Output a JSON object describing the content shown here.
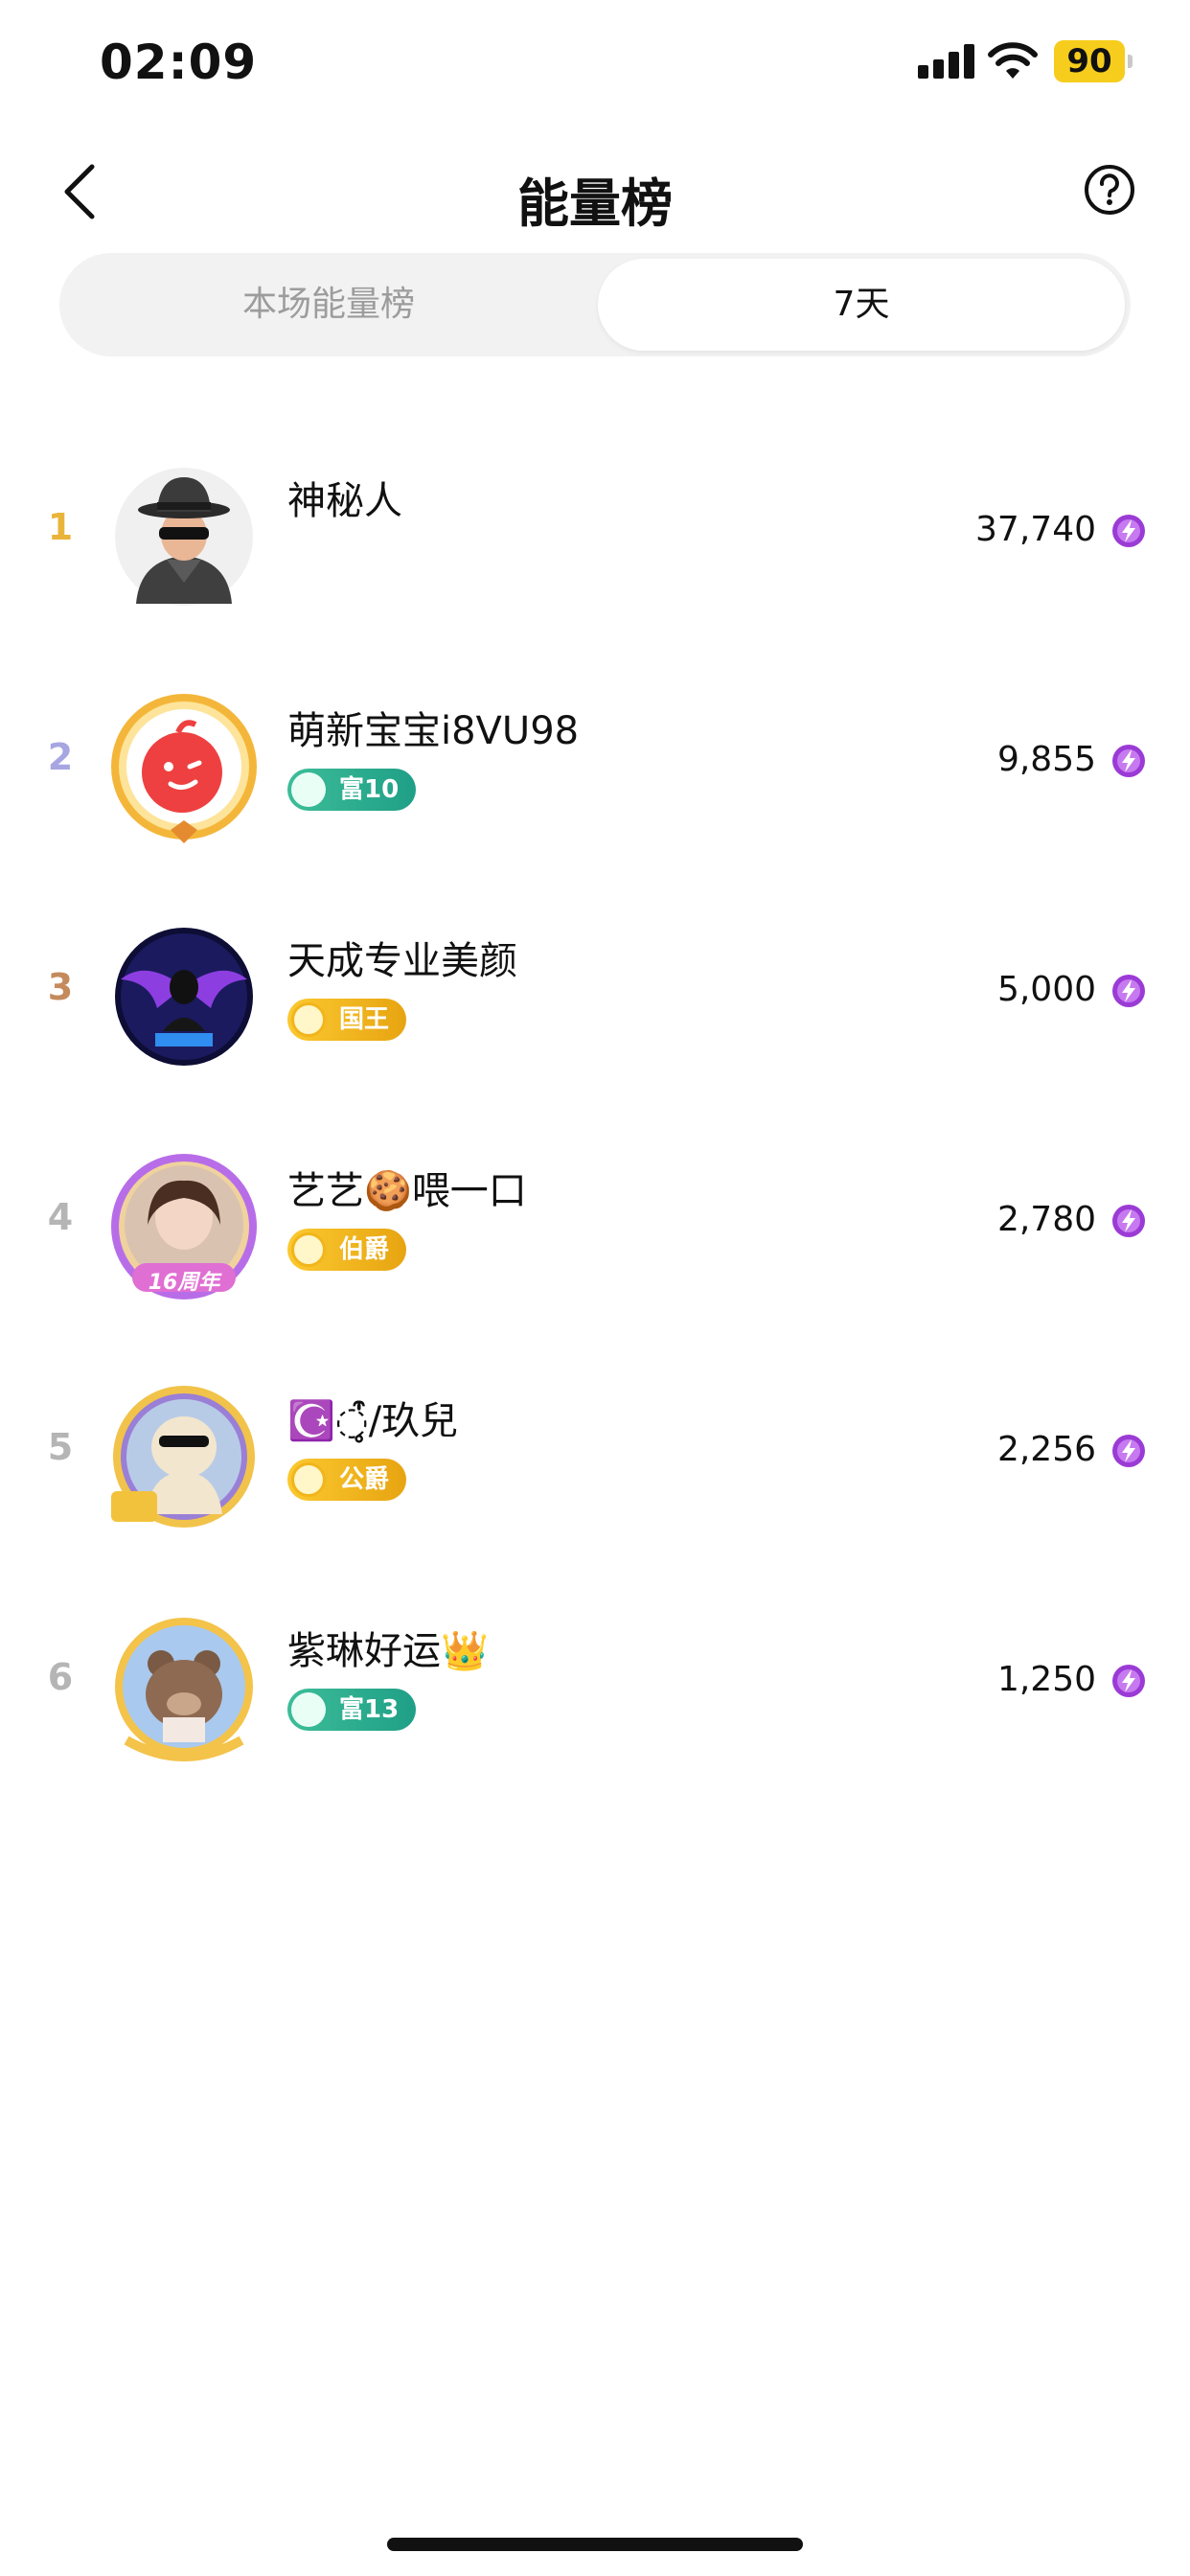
{
  "status_bar": {
    "time": "02:09",
    "battery": "90"
  },
  "nav": {
    "title": "能量榜"
  },
  "tabs": [
    {
      "label": "本场能量榜",
      "selected": false
    },
    {
      "label": "7天",
      "selected": true
    }
  ],
  "colors": {
    "rank_1": "#e9b43a",
    "rank_2": "#a7a6e2",
    "rank_3": "#c58a5c",
    "rank_other": "#b5b5b5",
    "energy_icon": "#9b3bd6"
  },
  "rows": [
    {
      "rank": "1",
      "name": "神秘人",
      "badge": "",
      "score": "37,740"
    },
    {
      "rank": "2",
      "name": "萌新宝宝i8VU98",
      "badge": "富10",
      "score": "9,855"
    },
    {
      "rank": "3",
      "name": "天成专业美颜",
      "badge": "国王",
      "score": "5,000"
    },
    {
      "rank": "4",
      "name": "艺艺🍪喂一口",
      "badge": "伯爵",
      "score": "2,780",
      "avatar_text": "16周年"
    },
    {
      "rank": "5",
      "name": "☪️◌̥̥͒͒̍̍/玖兒",
      "badge": "公爵",
      "score": "2,256"
    },
    {
      "rank": "6",
      "name": "紫琳好运👑",
      "badge": "富13",
      "score": "1,250"
    }
  ]
}
